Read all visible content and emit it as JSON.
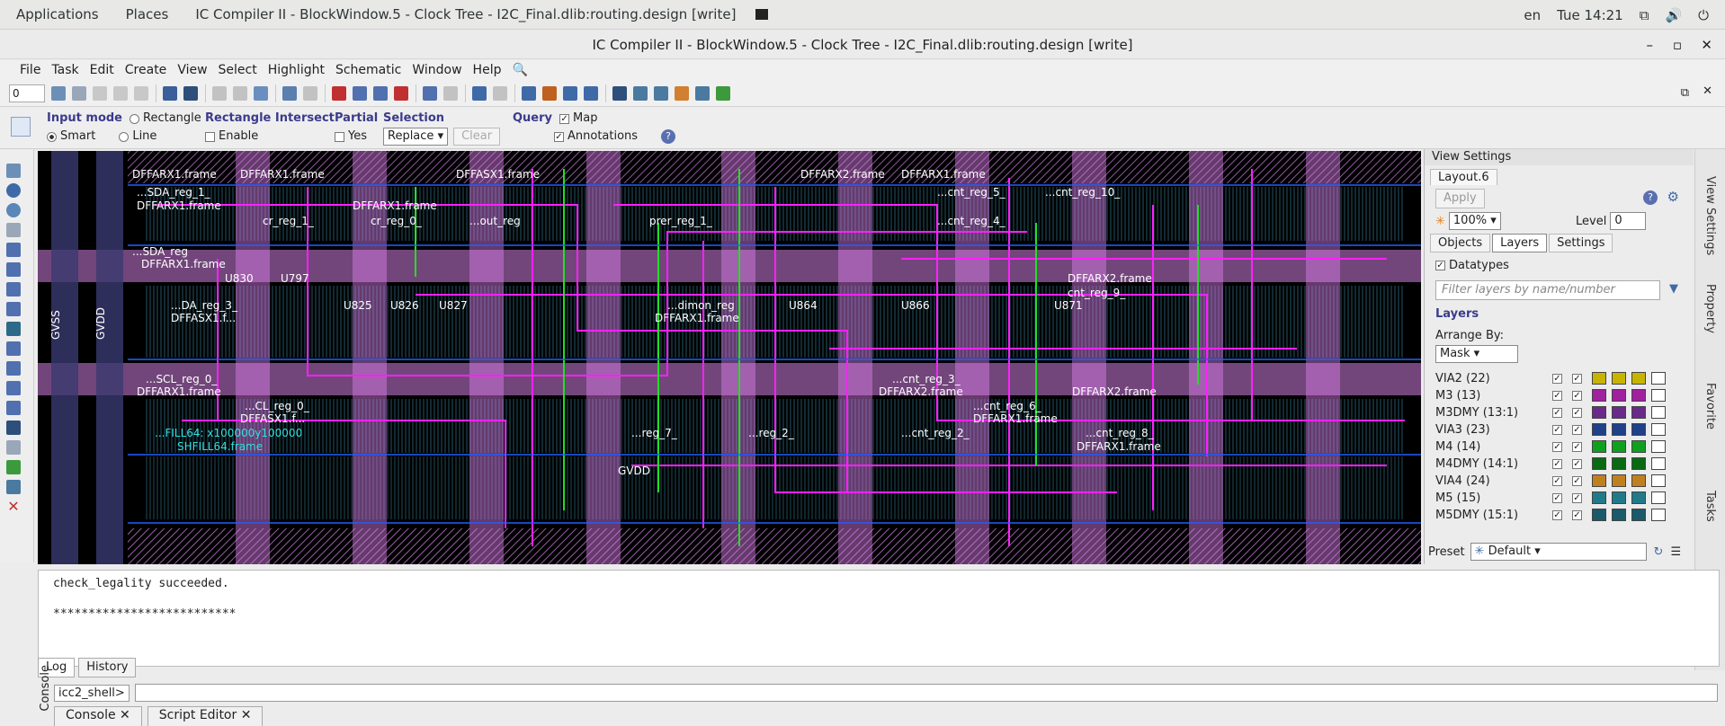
{
  "topbar": {
    "applications": "Applications",
    "places": "Places",
    "window_title": "IC Compiler II - BlockWindow.5 - Clock Tree - I2C_Final.dlib:routing.design [write]",
    "lang": "en",
    "clock": "Tue 14:21"
  },
  "window": {
    "title": "IC Compiler II - BlockWindow.5 - Clock Tree - I2C_Final.dlib:routing.design [write]"
  },
  "menu": [
    "File",
    "Task",
    "Edit",
    "Create",
    "View",
    "Select",
    "Highlight",
    "Schematic",
    "Window",
    "Help"
  ],
  "toolbar": {
    "spin_value": "0"
  },
  "options": {
    "input_mode": {
      "title": "Input mode",
      "rectangle": "Rectangle",
      "smart": "Smart",
      "line": "Line"
    },
    "rect_intersect": {
      "title": "Rectangle Intersect",
      "enable": "Enable"
    },
    "partial": {
      "title": "Partial",
      "yes": "Yes"
    },
    "selection": {
      "title": "Selection",
      "value": "Replace",
      "clear": "Clear"
    },
    "query": {
      "title": "Query",
      "map": "Map",
      "annotations": "Annotations"
    }
  },
  "layout": {
    "labels": [
      "DFFARX1.frame",
      "DFFARX1.frame",
      "DFFASX1.frame",
      "DFFARX2.frame",
      "DFFARX1.frame",
      "...SDA_reg_1_",
      "DFFARX1.frame",
      "DFFARX1.frame",
      "...cnt_reg_5_",
      "...cnt_reg_10_",
      "cr_reg_1_",
      "cr_reg_0_",
      "...out_reg",
      "prer_reg_1_",
      "...cnt_reg_4_",
      "...SDA_reg",
      "DFFARX1.frame",
      "U830",
      "U797",
      "U825",
      "U826",
      "U827",
      "U864",
      "U866",
      "...DA_reg_3_",
      "DFFASX1.f...",
      "DFFARX1.frame",
      "...dimon_reg",
      "U871",
      "...SCL_reg_0_",
      "DFFARX1.frame",
      "...cnt_reg_3_",
      "DFFARX2.frame",
      "...CL_reg_0_",
      "DFFASX1.f...",
      "...cnt_reg_6_",
      "DFFARX1.frame",
      "...FILL64: x100000y100000",
      "SHFILL64.frame",
      "...reg_7_",
      "...reg_2_",
      "...cnt_reg_2_",
      "...cnt_reg_8_",
      "GVSS",
      "GVDD",
      "GVDD",
      "cnt_reg_9_",
      "DFFARX2.frame",
      "DFFARX2.frame",
      "DFFARX1.frame"
    ]
  },
  "view_settings": {
    "title": "View Settings",
    "layout_tab": "Layout.6",
    "apply": "Apply",
    "zoom": "100%",
    "level_label": "Level",
    "level": "0",
    "tabs": [
      "Objects",
      "Layers",
      "Settings"
    ],
    "datatypes": "Datatypes",
    "filter_placeholder": "Filter layers by name/number",
    "layers_header": "Layers",
    "arrange_by": "Arrange By:",
    "arrange_value": "Mask",
    "layers": [
      {
        "name": "VIA2 (22)",
        "color": "#c8b400"
      },
      {
        "name": "M3 (13)",
        "color": "#a020a0"
      },
      {
        "name": "M3DMY (13:1)",
        "color": "#6a2a8a"
      },
      {
        "name": "VIA3 (23)",
        "color": "#20408a"
      },
      {
        "name": "M4 (14)",
        "color": "#10a020"
      },
      {
        "name": "M4DMY (14:1)",
        "color": "#0a6a14"
      },
      {
        "name": "VIA4 (24)",
        "color": "#c08020"
      },
      {
        "name": "M5 (15)",
        "color": "#207a8a"
      },
      {
        "name": "M5DMY (15:1)",
        "color": "#1a5a6a"
      }
    ],
    "preset_label": "Preset",
    "preset_value": "Default"
  },
  "dock": [
    "View Settings",
    "Property",
    "Favorite",
    "Tasks"
  ],
  "console": {
    "lines": [
      "check_legality succeeded.",
      "",
      "**************************"
    ],
    "tabs": [
      "Log",
      "History"
    ],
    "prompt": "icc2_shell>",
    "label": "Console"
  },
  "bottom_tabs": [
    "Console",
    "Script Editor"
  ]
}
